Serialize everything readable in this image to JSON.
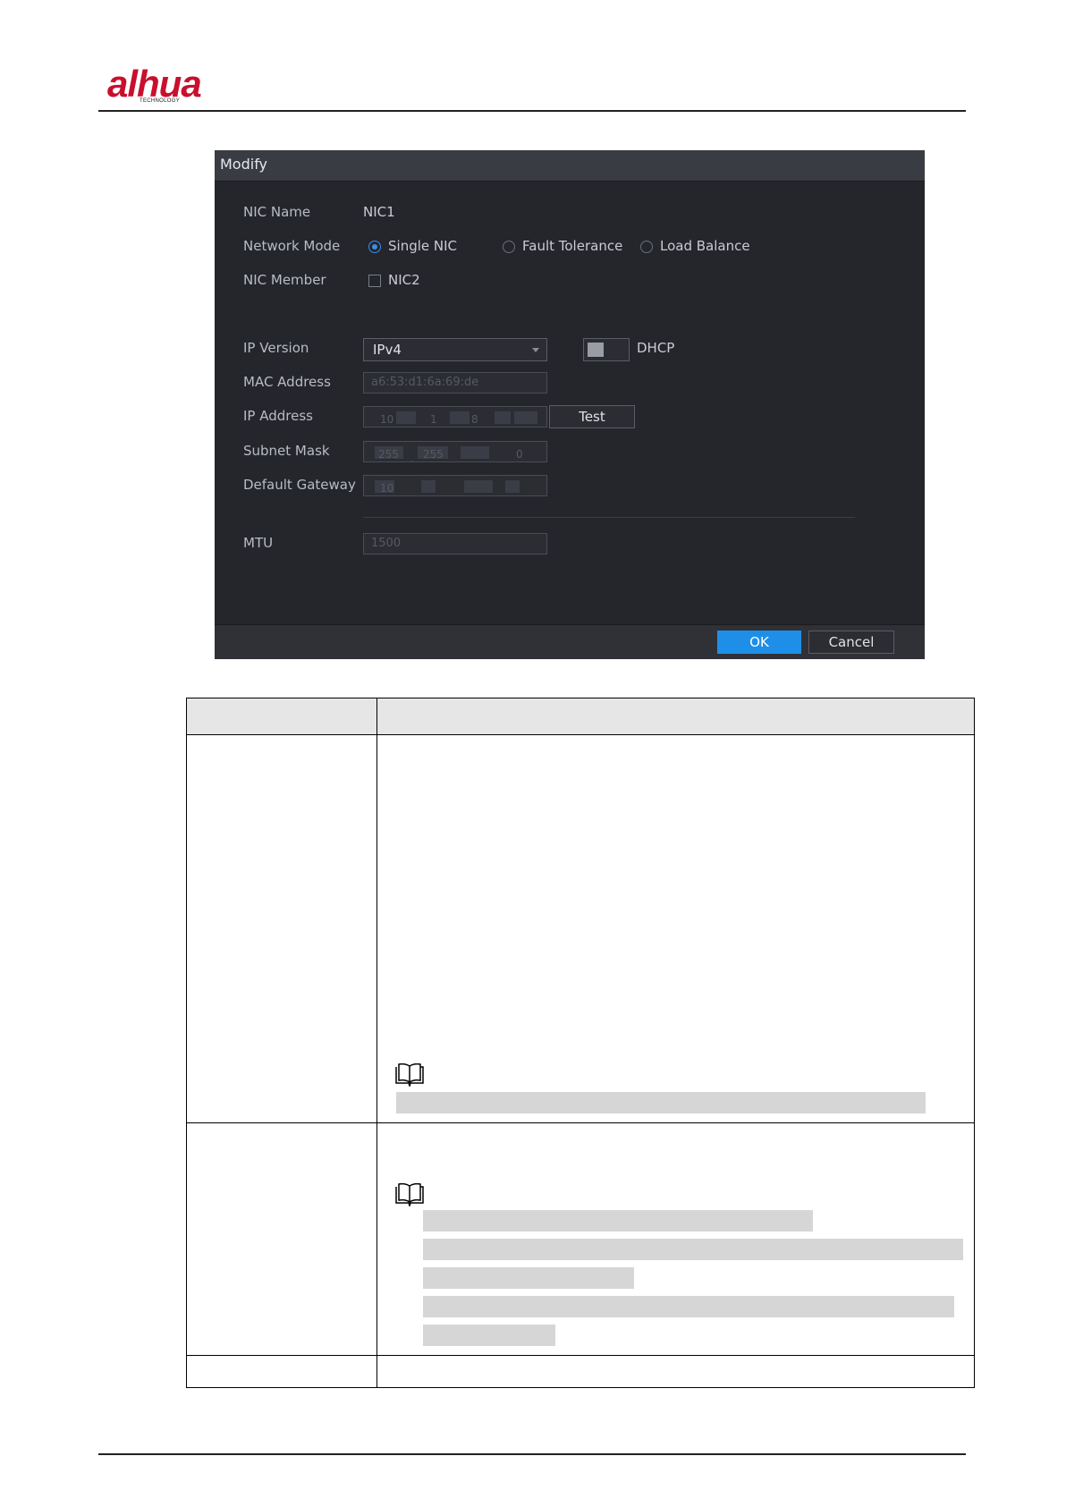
{
  "header": {
    "logo_text": "alhua",
    "logo_subtext": "TECHNOLOGY"
  },
  "dialog": {
    "title": "Modify",
    "nic_name": {
      "label": "NIC Name",
      "value": "NIC1"
    },
    "network_mode": {
      "label": "Network Mode",
      "options": [
        "Single NIC",
        "Fault Tolerance",
        "Load Balance"
      ],
      "selected": "Single NIC"
    },
    "nic_member": {
      "label": "NIC Member",
      "option": "NIC2",
      "checked": false
    },
    "ip_version": {
      "label": "IP Version",
      "value": "IPv4"
    },
    "dhcp": {
      "label": "DHCP",
      "enabled": false
    },
    "mac_address": {
      "label": "MAC Address",
      "value": "a6:53:d1:6a:69:de"
    },
    "ip_address": {
      "label": "IP Address",
      "parts": [
        "10",
        "1",
        "8",
        ""
      ]
    },
    "test_button": "Test",
    "subnet_mask": {
      "label": "Subnet Mask",
      "parts": [
        "255",
        "255",
        "",
        "0"
      ]
    },
    "default_gateway": {
      "label": "Default Gateway",
      "parts": [
        "10",
        "",
        "",
        ""
      ]
    },
    "mtu": {
      "label": "MTU",
      "value": "1500"
    },
    "ok_button": "OK",
    "cancel_button": "Cancel"
  },
  "colors": {
    "dialog_bg": "#24262c",
    "accent": "#1e8fe8",
    "logo": "#c8102e"
  },
  "icons": [
    "note-book-icon"
  ]
}
